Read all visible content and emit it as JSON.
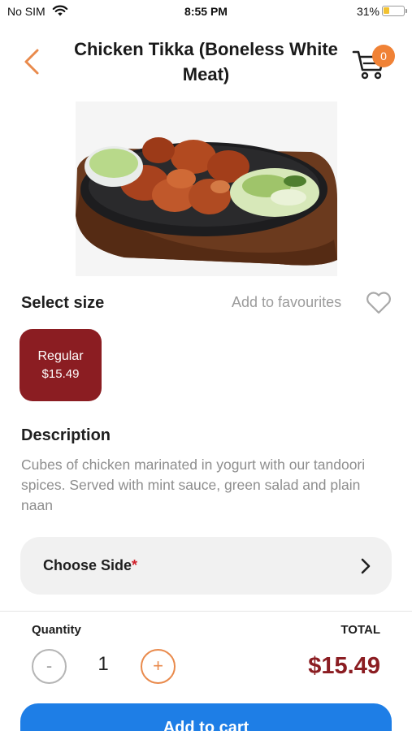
{
  "status_bar": {
    "carrier": "No SIM",
    "time": "8:55 PM",
    "battery": "31%",
    "battery_level": 0.31
  },
  "header": {
    "title": "Chicken Tikka (Boneless White Meat)",
    "cart_count": "0",
    "accent_color": "#f08236"
  },
  "size": {
    "label": "Select size",
    "favourite_label": "Add to favourites",
    "options": [
      {
        "name": "Regular",
        "price": "$15.49",
        "selected": true
      }
    ],
    "selected_color": "#8b1d22"
  },
  "description": {
    "title": "Description",
    "text": "Cubes of chicken marinated in yogurt with our tandoori spices. Served with mint sauce, green salad and plain naan"
  },
  "choose_side": {
    "label": "Choose Side",
    "required_mark": "*"
  },
  "order": {
    "quantity_label": "Quantity",
    "quantity": "1",
    "total_label": "TOTAL",
    "total": "$15.49",
    "minus_symbol": "-",
    "plus_symbol": "+"
  },
  "actions": {
    "add_to_cart": "Add to cart",
    "button_color": "#1e7ee6"
  },
  "icons": [
    "wifi-icon",
    "battery-icon",
    "back-chevron-icon",
    "cart-icon",
    "heart-icon",
    "chevron-right-icon"
  ]
}
